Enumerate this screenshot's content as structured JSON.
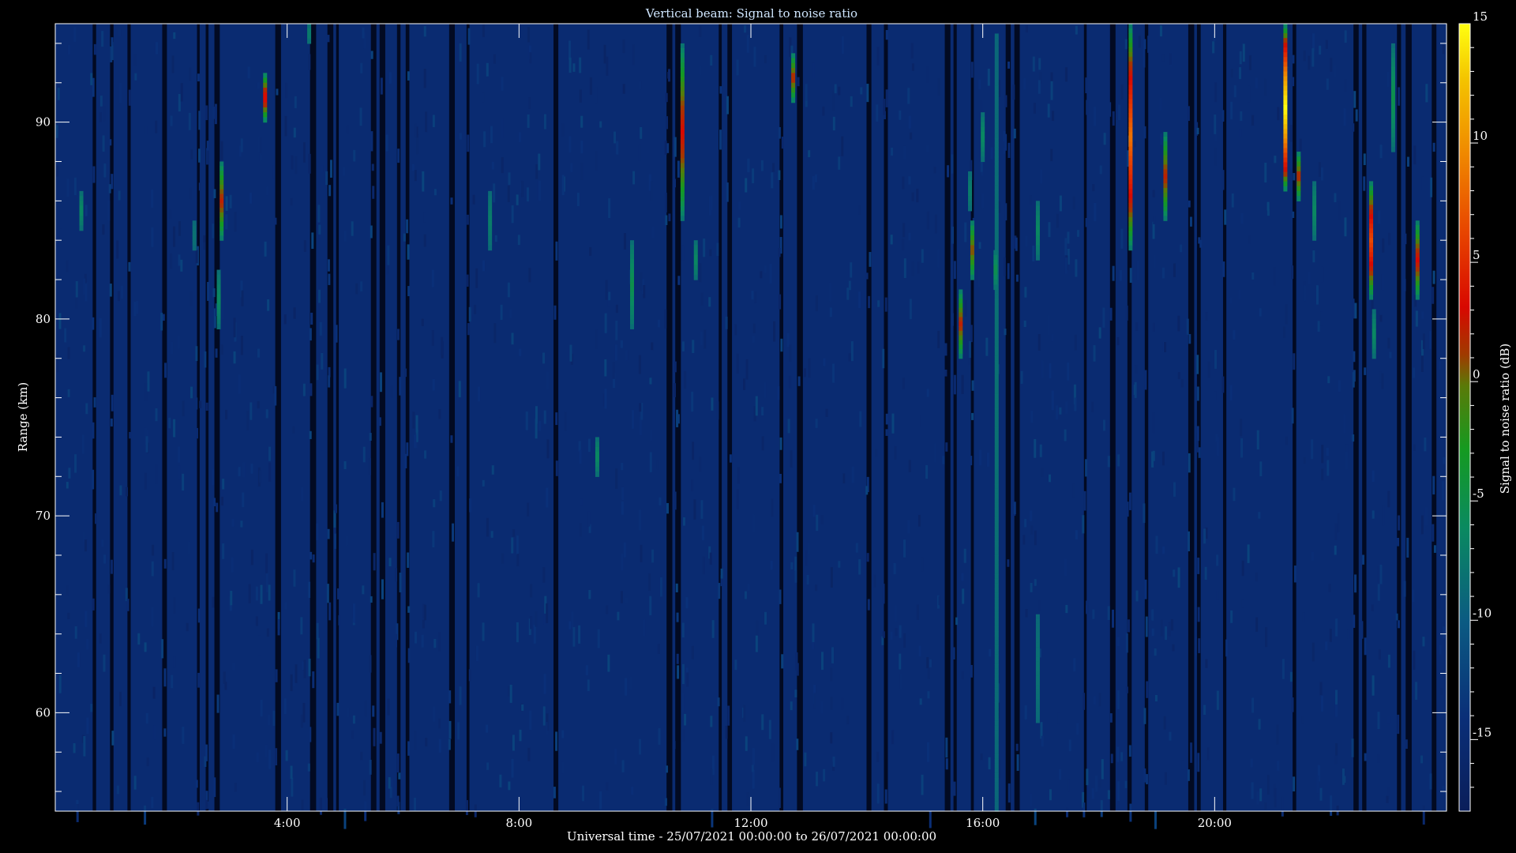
{
  "chart_data": {
    "type": "heatmap",
    "title": "Vertical beam: Signal to noise ratio",
    "xlabel": "Universal time - 25/07/2021 00:00:00 to 26/07/2021 00:00:00",
    "ylabel": "Range (km)",
    "colorbar_label": "Signal to noise ratio (dB)",
    "xlim_hours": [
      0,
      24
    ],
    "ylim_km": [
      55,
      95
    ],
    "clim_db": [
      -18,
      15
    ],
    "x_ticks": [
      {
        "hour": 4,
        "label": "4:00"
      },
      {
        "hour": 8,
        "label": "8:00"
      },
      {
        "hour": 12,
        "label": "12:00"
      },
      {
        "hour": 16,
        "label": "16:00"
      },
      {
        "hour": 20,
        "label": "20:00"
      }
    ],
    "y_ticks": [
      {
        "km": 60,
        "label": "60"
      },
      {
        "km": 70,
        "label": "70"
      },
      {
        "km": 80,
        "label": "80"
      },
      {
        "km": 90,
        "label": "90"
      }
    ],
    "colorbar_ticks": [
      {
        "db": 15,
        "label": "15"
      },
      {
        "db": 10,
        "label": "10"
      },
      {
        "db": 5,
        "label": "5"
      },
      {
        "db": 0,
        "label": "0"
      },
      {
        "db": -5,
        "label": "-5"
      },
      {
        "db": -10,
        "label": "-10"
      },
      {
        "db": -15,
        "label": "-15"
      }
    ],
    "background_db": -15,
    "echoes": [
      {
        "hour": 0.45,
        "km_min": 84.5,
        "km_max": 86.5,
        "peak_db": -6
      },
      {
        "hour": 2.4,
        "km_min": 83.5,
        "km_max": 85.0,
        "peak_db": -8
      },
      {
        "hour": 2.82,
        "km_min": 79.5,
        "km_max": 82.5,
        "peak_db": -6
      },
      {
        "hour": 2.87,
        "km_min": 84.0,
        "km_max": 88.0,
        "peak_db": 1
      },
      {
        "hour": 3.62,
        "km_min": 90.0,
        "km_max": 92.5,
        "peak_db": 3
      },
      {
        "hour": 4.38,
        "km_min": 94.0,
        "km_max": 95.0,
        "peak_db": -7
      },
      {
        "hour": 7.5,
        "km_min": 83.5,
        "km_max": 86.5,
        "peak_db": -7
      },
      {
        "hour": 9.35,
        "km_min": 72.0,
        "km_max": 74.0,
        "peak_db": -6
      },
      {
        "hour": 9.95,
        "km_min": 79.5,
        "km_max": 84.0,
        "peak_db": -5
      },
      {
        "hour": 10.82,
        "km_min": 85.0,
        "km_max": 94.0,
        "peak_db": 2
      },
      {
        "hour": 11.05,
        "km_min": 82.0,
        "km_max": 84.0,
        "peak_db": -6
      },
      {
        "hour": 12.73,
        "km_min": 91.0,
        "km_max": 93.5,
        "peak_db": 1
      },
      {
        "hour": 16.0,
        "km_min": 88.0,
        "km_max": 90.5,
        "peak_db": -6
      },
      {
        "hour": 15.62,
        "km_min": 78.0,
        "km_max": 81.5,
        "peak_db": 1
      },
      {
        "hour": 15.78,
        "km_min": 85.5,
        "km_max": 87.5,
        "peak_db": -7
      },
      {
        "hour": 15.82,
        "km_min": 82.0,
        "km_max": 85.0,
        "peak_db": 0
      },
      {
        "hour": 16.24,
        "km_min": 55.0,
        "km_max": 94.5,
        "peak_db": -8
      },
      {
        "hour": 16.22,
        "km_min": 81.5,
        "km_max": 83.5,
        "peak_db": -5
      },
      {
        "hour": 16.95,
        "km_min": 83.0,
        "km_max": 86.0,
        "peak_db": -6
      },
      {
        "hour": 16.95,
        "km_min": 59.5,
        "km_max": 65.0,
        "peak_db": -8
      },
      {
        "hour": 18.55,
        "km_min": 83.5,
        "km_max": 95.0,
        "peak_db": 8
      },
      {
        "hour": 19.15,
        "km_min": 85.0,
        "km_max": 89.5,
        "peak_db": 1
      },
      {
        "hour": 21.22,
        "km_min": 86.5,
        "km_max": 95.0,
        "peak_db": 15
      },
      {
        "hour": 21.45,
        "km_min": 86.0,
        "km_max": 88.5,
        "peak_db": 1
      },
      {
        "hour": 21.72,
        "km_min": 84.0,
        "km_max": 87.0,
        "peak_db": -6
      },
      {
        "hour": 22.7,
        "km_min": 81.0,
        "km_max": 87.0,
        "peak_db": 6
      },
      {
        "hour": 22.75,
        "km_min": 78.0,
        "km_max": 80.5,
        "peak_db": -6
      },
      {
        "hour": 23.08,
        "km_min": 88.5,
        "km_max": 94.0,
        "peak_db": -5
      },
      {
        "hour": 23.5,
        "km_min": 81.0,
        "km_max": 85.0,
        "peak_db": 2
      }
    ]
  }
}
